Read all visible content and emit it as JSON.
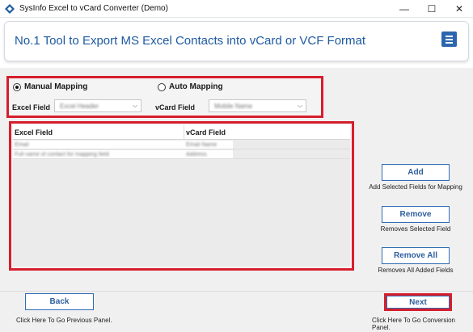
{
  "window": {
    "title": "SysInfo Excel to vCard Converter (Demo)",
    "controls": {
      "minimize": "—",
      "maximize": "☐",
      "close": "✕"
    }
  },
  "header": {
    "title": "No.1 Tool to Export MS Excel Contacts into vCard or VCF Format",
    "menu_icon": "hamburger-menu-icon"
  },
  "mapping": {
    "manual_label": "Manual Mapping",
    "auto_label": "Auto Mapping",
    "selected": "manual",
    "excel_field_label": "Excel Field",
    "excel_field_value": "Excel Header",
    "vcard_field_label": "vCard Field",
    "vcard_field_value": "Mobile Name"
  },
  "grid": {
    "columns": [
      "Excel Field",
      "vCard Field"
    ],
    "rows": [
      [
        "Email",
        "Email Name"
      ],
      [
        "Full name of contact for mapping field",
        "Address"
      ]
    ]
  },
  "actions": {
    "add_label": "Add",
    "add_caption": "Add Selected Fields for Mapping",
    "remove_label": "Remove",
    "remove_caption": "Removes Selected Field",
    "remove_all_label": "Remove All",
    "remove_all_caption": "Removes All Added Fields"
  },
  "footer": {
    "back_label": "Back",
    "back_caption": "Click Here To Go Previous Panel.",
    "next_label": "Next",
    "next_caption": "Click Here To Go Conversion Panel."
  },
  "colors": {
    "accent": "#2c67ad",
    "highlight": "#d61e2d",
    "title": "#1e5aa0"
  }
}
